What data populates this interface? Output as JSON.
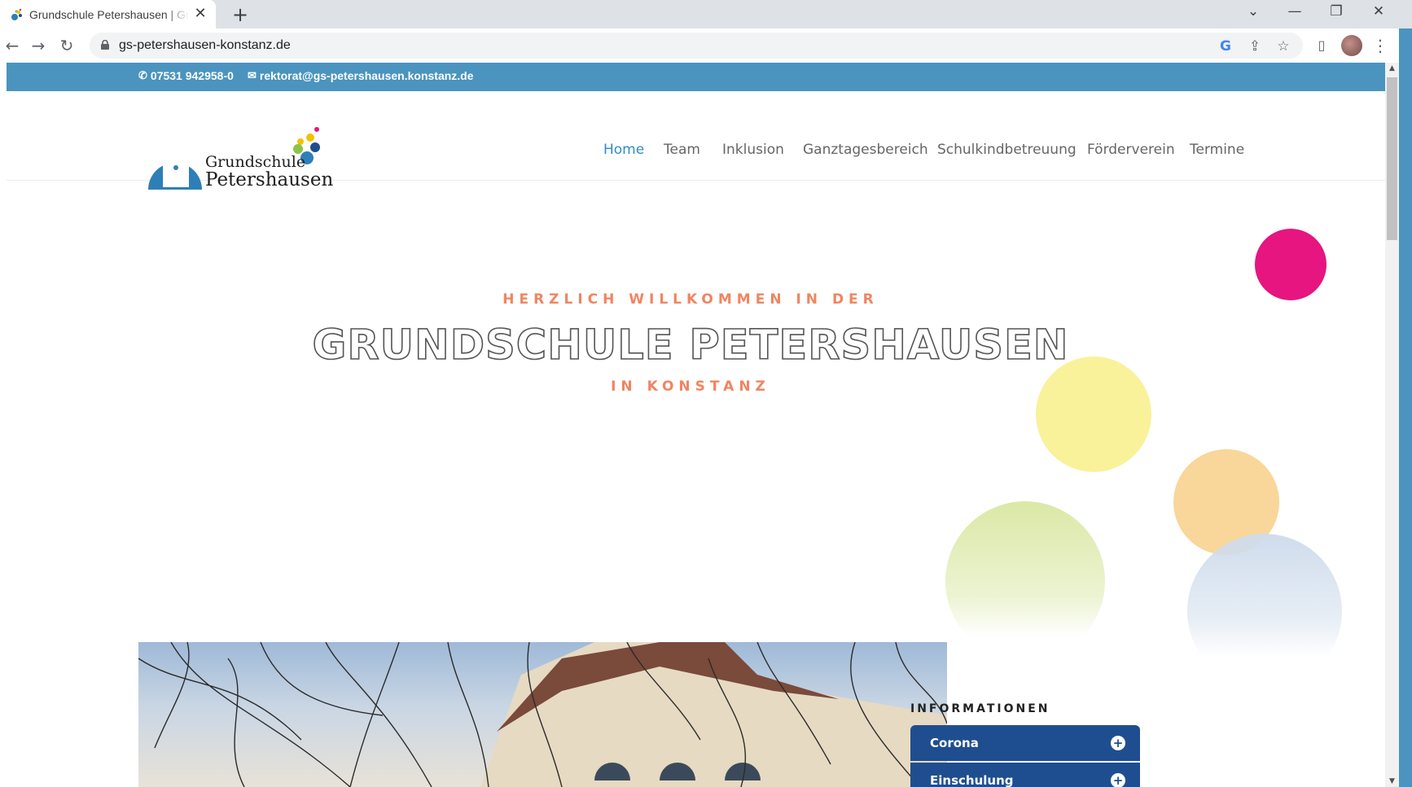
{
  "browser": {
    "tab_title": "Grundschule Petershausen | Grundschule Petershausen",
    "tab_close": "✕",
    "new_tab": "+",
    "url": "gs-petershausen-konstanz.de",
    "controls": {
      "dropdown": "⌄",
      "minimize": "—",
      "restore": "❐",
      "close": "✕"
    }
  },
  "topbar": {
    "phone": "07531 942958-0",
    "email": "rektorat@gs-petershausen.konstanz.de"
  },
  "logo": {
    "line1": "Grundschule",
    "line2": "Petershausen"
  },
  "nav": {
    "items": [
      "Home",
      "Team",
      "Inklusion",
      "Ganztagesbereich",
      "Schulkindbetreuung",
      "Förderverein",
      "Termine"
    ],
    "active": "Home"
  },
  "hero": {
    "eyebrow": "HERZLICH WILLKOMMEN IN DER",
    "title": "GRUNDSCHULE PETERSHAUSEN",
    "subtitle": "IN KONSTANZ"
  },
  "info": {
    "title": "INFORMATIONEN",
    "accordion": [
      {
        "label": "Corona"
      },
      {
        "label": "Einschulung"
      }
    ]
  },
  "colors": {
    "topbar": "#4a94bf",
    "accent_orange": "#f08561",
    "nav_active": "#2e8ec6",
    "accordion": "#1f4e90",
    "bubble_pink": "#e6157f",
    "bubble_yellow": "#f9ee8a",
    "bubble_orange": "#f8cc80",
    "bubble_green": "#dbe8a6",
    "bubble_blue": "#cfdcec"
  }
}
